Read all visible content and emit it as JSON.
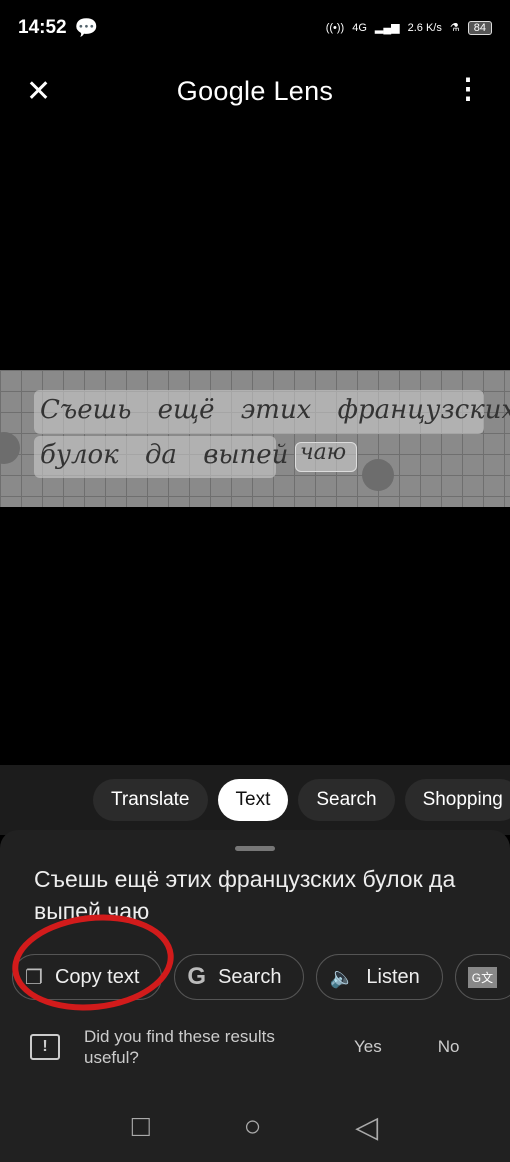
{
  "status": {
    "time": "14:52",
    "network": "4G",
    "speed": "2.6 K/s",
    "battery": "84"
  },
  "header": {
    "title": "Google Lens"
  },
  "image_text": {
    "line1": "Съешь ещё этих французских",
    "line2": "булок да выпей",
    "line3": "чаю"
  },
  "tabs": [
    {
      "label": "Translate"
    },
    {
      "label": "Text",
      "active": true
    },
    {
      "label": "Search"
    },
    {
      "label": "Shopping"
    }
  ],
  "result": {
    "text": "Съешь ещё этих французских булок да выпей чаю"
  },
  "actions": [
    {
      "label": "Copy text",
      "icon": "copy-icon"
    },
    {
      "label": "Search",
      "icon": "google-g-icon"
    },
    {
      "label": "Listen",
      "icon": "speaker-icon"
    },
    {
      "label": "",
      "icon": "translate-icon"
    }
  ],
  "feedback": {
    "question": "Did you find these results useful?",
    "yes": "Yes",
    "no": "No"
  },
  "annotation_color": "#d21b1b"
}
